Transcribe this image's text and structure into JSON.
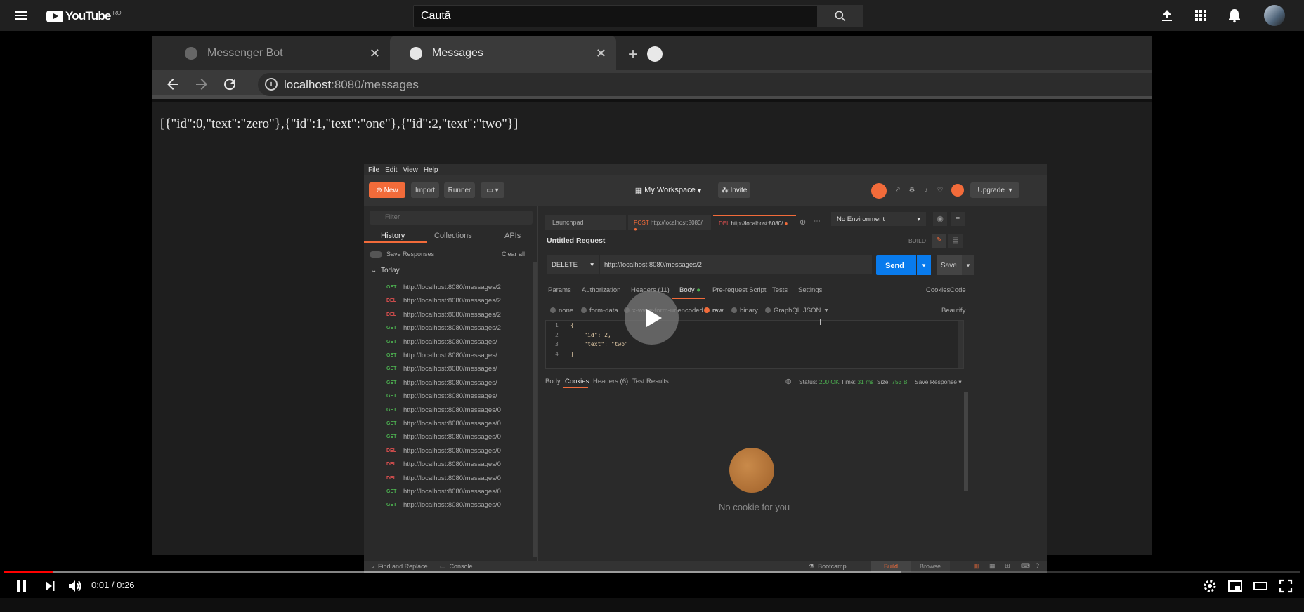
{
  "youtube": {
    "logo_text": "YouTube",
    "country_code": "RO",
    "search_placeholder": "Caută"
  },
  "browser": {
    "tabs": [
      {
        "title": "Messenger Bot",
        "active": false
      },
      {
        "title": "Messages",
        "active": true
      }
    ],
    "url_host": "localhost",
    "url_rest": ":8080/messages",
    "page_text": "[{\"id\":0,\"text\":\"zero\"},{\"id\":1,\"text\":\"one\"},{\"id\":2,\"text\":\"two\"}]"
  },
  "postman": {
    "menu": [
      "File",
      "Edit",
      "View",
      "Help"
    ],
    "header": {
      "new": "New",
      "import": "Import",
      "runner": "Runner",
      "workspace": "My Workspace",
      "invite": "Invite",
      "upgrade": "Upgrade"
    },
    "sidebar": {
      "filter_placeholder": "Filter",
      "tabs": [
        "History",
        "Collections",
        "APIs"
      ],
      "save_responses": "Save Responses",
      "clear_all": "Clear all",
      "group": "Today",
      "history": [
        {
          "method": "GET",
          "url": "http://localhost:8080/messages/2"
        },
        {
          "method": "DEL",
          "url": "http://localhost:8080/messages/2"
        },
        {
          "method": "DEL",
          "url": "http://localhost:8080/messages/2"
        },
        {
          "method": "GET",
          "url": "http://localhost:8080/messages/2"
        },
        {
          "method": "GET",
          "url": "http://localhost:8080/messages/"
        },
        {
          "method": "GET",
          "url": "http://localhost:8080/messages/"
        },
        {
          "method": "GET",
          "url": "http://localhost:8080/messages/"
        },
        {
          "method": "GET",
          "url": "http://localhost:8080/messages/"
        },
        {
          "method": "GET",
          "url": "http://localhost:8080/messages/"
        },
        {
          "method": "GET",
          "url": "http://localhost:8080/messages/0"
        },
        {
          "method": "GET",
          "url": "http://localhost:8080/messages/0"
        },
        {
          "method": "GET",
          "url": "http://localhost:8080/messages/0"
        },
        {
          "method": "DEL",
          "url": "http://localhost:8080/messages/0"
        },
        {
          "method": "DEL",
          "url": "http://localhost:8080/messages/0"
        },
        {
          "method": "DEL",
          "url": "http://localhost:8080/messages/0"
        },
        {
          "method": "GET",
          "url": "http://localhost:8080/messages/0"
        },
        {
          "method": "GET",
          "url": "http://localhost:8080/messages/0"
        }
      ]
    },
    "request_tabs": [
      {
        "method": "",
        "label": "Launchpad"
      },
      {
        "method": "POST",
        "label": "http://localhost:8080/"
      },
      {
        "method": "DEL",
        "label": "http://localhost:8080/"
      }
    ],
    "environment": "No Environment",
    "request_title": "Untitled Request",
    "build_label": "BUILD",
    "method": "DELETE",
    "url": "http://localhost:8080/messages/2",
    "send": "Send",
    "save": "Save",
    "req_subtabs": [
      "Params",
      "Authorization",
      "Headers (11)",
      "Body",
      "Pre-request Script",
      "Tests",
      "Settings"
    ],
    "cookies_link": "Cookies",
    "code_link": "Code",
    "body_types": [
      "none",
      "form-data",
      "x-www-form-urlencoded",
      "raw",
      "binary",
      "GraphQL"
    ],
    "body_format": "JSON",
    "beautify": "Beautify",
    "code_lines": [
      "{",
      "    \"id\": 2,",
      "    \"text\": \"two\"",
      "}"
    ],
    "line_numbers": [
      "1",
      "2",
      "3",
      "4"
    ],
    "resp_tabs": [
      "Body",
      "Cookies",
      "Headers (6)",
      "Test Results"
    ],
    "status_label": "Status:",
    "status_value": "200 OK",
    "time_label": "Time:",
    "time_value": "31 ms",
    "size_label": "Size:",
    "size_value": "753 B",
    "save_response": "Save Response",
    "no_cookie_text": "No cookie for you",
    "bottom": {
      "find_replace": "Find and Replace",
      "console": "Console",
      "bootcamp": "Bootcamp",
      "build": "Build",
      "browse": "Browse"
    }
  },
  "player": {
    "current_time": "0:01",
    "duration": "0:26",
    "time_display": "0:01 / 0:26",
    "progress_fraction": 0.038,
    "buffered_fraction": 0.692
  }
}
